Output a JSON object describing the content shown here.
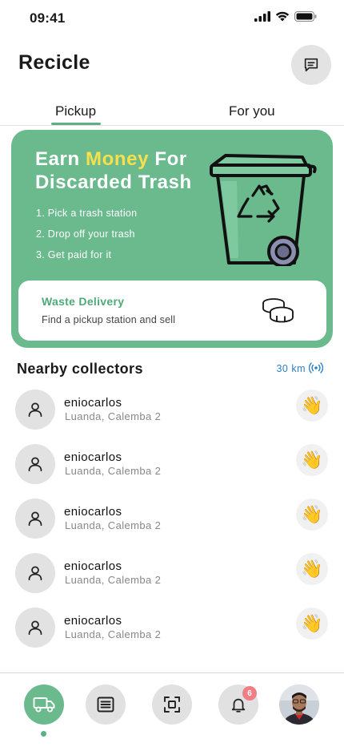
{
  "status_bar": {
    "time": "09:41",
    "icons": [
      "signal-icon",
      "wifi-icon",
      "battery-icon"
    ]
  },
  "header": {
    "title": "Recicle",
    "chat_icon": "chat-icon"
  },
  "tabs": [
    {
      "label": "Pickup",
      "active": true
    },
    {
      "label": "For you",
      "active": false
    }
  ],
  "promo": {
    "title_part1": "Earn ",
    "title_highlight": "Money",
    "title_part2": " For",
    "title_line2": "Discarded Trash",
    "steps": [
      "1. Pick a trash station",
      "2. Drop off your trash",
      "3. Get paid for it"
    ],
    "bin_icon": "recycle-bin-icon",
    "delivery": {
      "title": "Waste Delivery",
      "subtitle": "Find a pickup station and sell",
      "icon": "coins-icon"
    }
  },
  "nearby": {
    "title": "Nearby collectors",
    "distance": "30 km",
    "radar_icon": "radar-icon",
    "collectors": [
      {
        "name": "eniocarlos",
        "location": "Luanda, Calemba 2",
        "action": "👋"
      },
      {
        "name": "eniocarlos",
        "location": "Luanda, Calemba 2",
        "action": "👋"
      },
      {
        "name": "eniocarlos",
        "location": "Luanda, Calemba 2",
        "action": "👋"
      },
      {
        "name": "eniocarlos",
        "location": "Luanda, Calemba 2",
        "action": "👋"
      },
      {
        "name": "eniocarlos",
        "location": "Luanda, Calemba 2",
        "action": "👋"
      }
    ]
  },
  "bottom_nav": {
    "items": [
      {
        "icon": "truck-icon",
        "active": true
      },
      {
        "icon": "list-icon",
        "active": false
      },
      {
        "icon": "scan-icon",
        "active": false
      },
      {
        "icon": "bell-icon",
        "active": false,
        "badge": "6"
      },
      {
        "icon": "profile-avatar",
        "active": false
      }
    ]
  },
  "colors": {
    "primary_green": "#6bba8e",
    "accent_yellow": "#f6e04b",
    "link_blue": "#2b7fc7",
    "badge_pink": "#f07e86"
  }
}
